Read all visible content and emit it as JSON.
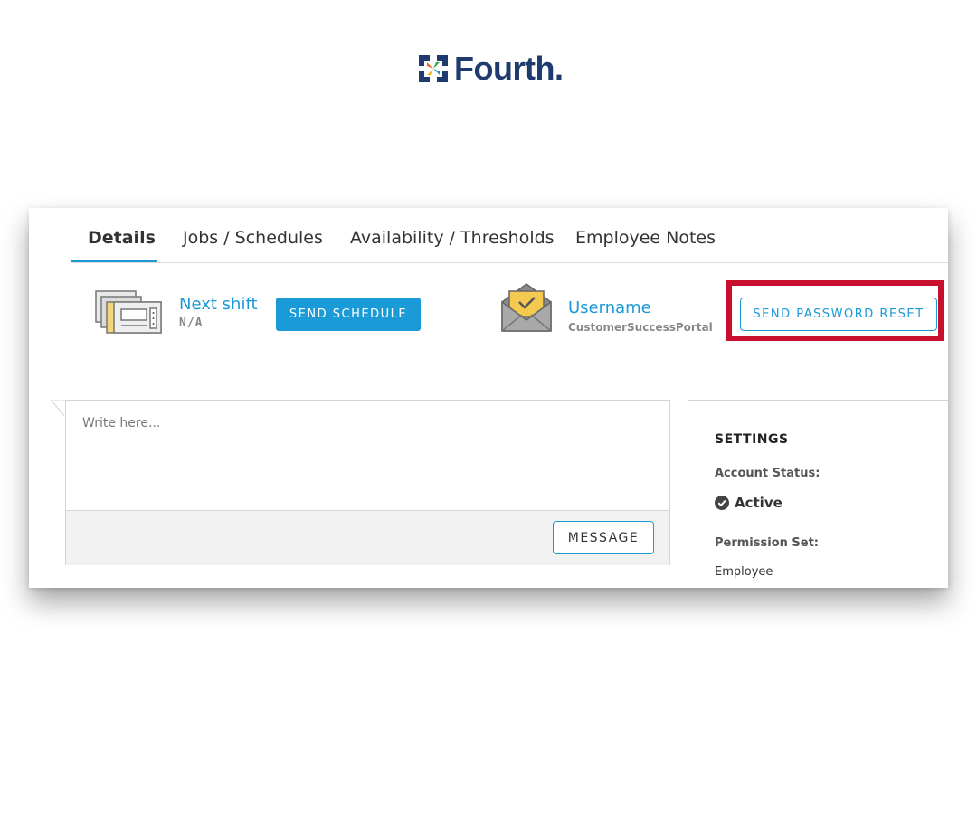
{
  "brand": {
    "name": "Fourth",
    "dot": "."
  },
  "tabs": [
    {
      "label": "Details"
    },
    {
      "label": "Jobs / Schedules"
    },
    {
      "label": "Availability / Thresholds"
    },
    {
      "label": "Employee Notes"
    }
  ],
  "schedule": {
    "label": "Next shift",
    "value": "N/A",
    "button": "SEND SCHEDULE",
    "icon": "schedule-cards-icon"
  },
  "account": {
    "label": "Username",
    "value": "CustomerSuccessPortal",
    "button": "SEND PASSWORD RESET",
    "icon": "envelope-check-icon",
    "highlight_color": "#c8102e"
  },
  "message": {
    "placeholder": "Write here...",
    "button": "MESSAGE"
  },
  "settings": {
    "title": "SETTINGS",
    "account_status_label": "Account Status:",
    "account_status": "Active",
    "permission_label": "Permission Set:",
    "permission": "Employee"
  },
  "colors": {
    "accent": "#1a9ad6",
    "brand": "#1f3a6e"
  }
}
